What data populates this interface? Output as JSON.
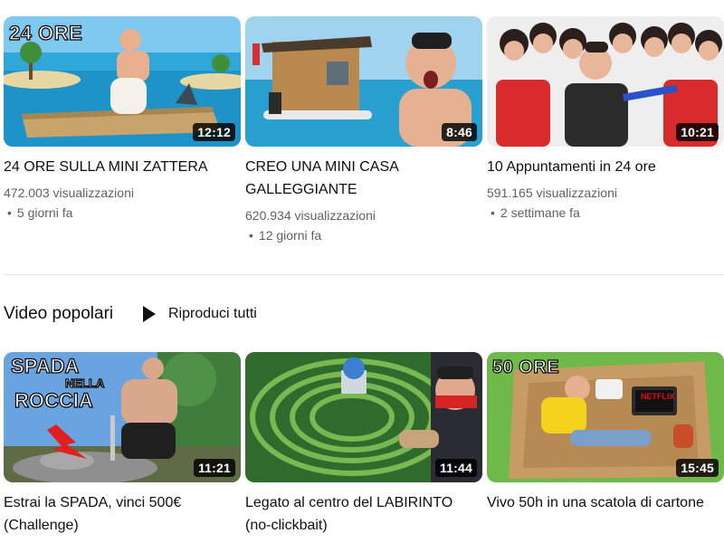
{
  "recent": [
    {
      "title": "24 ORE SULLA MINI ZATTERA",
      "views": "472.003 visualizzazioni",
      "age": "5 giorni fa",
      "duration": "12:12",
      "badge": "24 ORE",
      "thumb_icon": "raft-thumbnail"
    },
    {
      "title": "CREO UNA MINI CASA GALLEGGIANTE",
      "views": "620.934 visualizzazioni",
      "age": "12 giorni fa",
      "duration": "8:46",
      "badge": "",
      "thumb_icon": "floating-house-thumbnail"
    },
    {
      "title": "10 Appuntamenti in 24 ore",
      "views": "591.165 visualizzazioni",
      "age": "2 settimane fa",
      "duration": "10:21",
      "badge": "",
      "thumb_icon": "group-photo-thumbnail"
    }
  ],
  "section": {
    "title": "Video popolari",
    "play_all": "Riproduci tutti"
  },
  "popular": [
    {
      "title": "Estrai la SPADA, vinci 500€ (Challenge)",
      "duration": "11:21",
      "badge_l1": "SPADA",
      "badge_l2": "NELLA",
      "badge_l3": "ROCCIA",
      "thumb_icon": "sword-rock-thumbnail"
    },
    {
      "title": "Legato al centro del LABIRINTO (no-clickbait)",
      "duration": "11:44",
      "thumb_icon": "maze-thumbnail"
    },
    {
      "title": "Vivo 50h in una scatola di cartone",
      "duration": "15:45",
      "badge": "50 ORE",
      "netflix": "NETFLIX",
      "thumb_icon": "cardboard-box-thumbnail"
    }
  ],
  "separator": "•"
}
